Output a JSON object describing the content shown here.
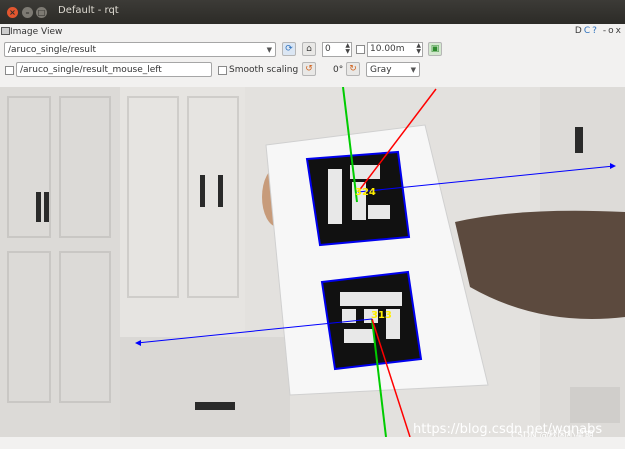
{
  "window": {
    "title": "Default - rqt"
  },
  "plugin": {
    "title": "Image View",
    "right_icons": [
      "D",
      "C",
      "?",
      "-",
      "o",
      "x"
    ]
  },
  "toolbar1": {
    "topic": "/aruco_single/result",
    "rotation_spin": "0",
    "distance_value": "10.00m"
  },
  "toolbar2": {
    "mouse_topic": "/aruco_single/result_mouse_left",
    "smooth_scaling_label": "Smooth scaling",
    "rotation_label": "0°",
    "color_scheme": "Gray"
  },
  "image": {
    "markers": [
      {
        "id": "324"
      },
      {
        "id": "313"
      }
    ],
    "watermark": "https://blog.csdn.net/wqnabs",
    "watermark2": "CSDN @秋闲小星期"
  },
  "colors": {
    "marker_box": "#0000ee",
    "axis_x": "#ff0000",
    "axis_y": "#00cc00",
    "axis_z": "#0000ff",
    "marker_label": "#ffee00"
  }
}
